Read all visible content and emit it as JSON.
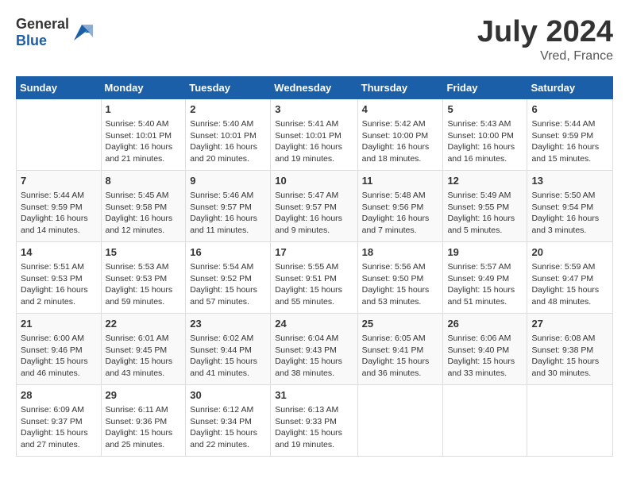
{
  "header": {
    "logo_general": "General",
    "logo_blue": "Blue",
    "month_year": "July 2024",
    "location": "Vred, France"
  },
  "weekdays": [
    "Sunday",
    "Monday",
    "Tuesday",
    "Wednesday",
    "Thursday",
    "Friday",
    "Saturday"
  ],
  "weeks": [
    [
      {
        "day": "",
        "sunrise": "",
        "sunset": "",
        "daylight": ""
      },
      {
        "day": "1",
        "sunrise": "Sunrise: 5:40 AM",
        "sunset": "Sunset: 10:01 PM",
        "daylight": "Daylight: 16 hours and 21 minutes."
      },
      {
        "day": "2",
        "sunrise": "Sunrise: 5:40 AM",
        "sunset": "Sunset: 10:01 PM",
        "daylight": "Daylight: 16 hours and 20 minutes."
      },
      {
        "day": "3",
        "sunrise": "Sunrise: 5:41 AM",
        "sunset": "Sunset: 10:01 PM",
        "daylight": "Daylight: 16 hours and 19 minutes."
      },
      {
        "day": "4",
        "sunrise": "Sunrise: 5:42 AM",
        "sunset": "Sunset: 10:00 PM",
        "daylight": "Daylight: 16 hours and 18 minutes."
      },
      {
        "day": "5",
        "sunrise": "Sunrise: 5:43 AM",
        "sunset": "Sunset: 10:00 PM",
        "daylight": "Daylight: 16 hours and 16 minutes."
      },
      {
        "day": "6",
        "sunrise": "Sunrise: 5:44 AM",
        "sunset": "Sunset: 9:59 PM",
        "daylight": "Daylight: 16 hours and 15 minutes."
      }
    ],
    [
      {
        "day": "7",
        "sunrise": "Sunrise: 5:44 AM",
        "sunset": "Sunset: 9:59 PM",
        "daylight": "Daylight: 16 hours and 14 minutes."
      },
      {
        "day": "8",
        "sunrise": "Sunrise: 5:45 AM",
        "sunset": "Sunset: 9:58 PM",
        "daylight": "Daylight: 16 hours and 12 minutes."
      },
      {
        "day": "9",
        "sunrise": "Sunrise: 5:46 AM",
        "sunset": "Sunset: 9:57 PM",
        "daylight": "Daylight: 16 hours and 11 minutes."
      },
      {
        "day": "10",
        "sunrise": "Sunrise: 5:47 AM",
        "sunset": "Sunset: 9:57 PM",
        "daylight": "Daylight: 16 hours and 9 minutes."
      },
      {
        "day": "11",
        "sunrise": "Sunrise: 5:48 AM",
        "sunset": "Sunset: 9:56 PM",
        "daylight": "Daylight: 16 hours and 7 minutes."
      },
      {
        "day": "12",
        "sunrise": "Sunrise: 5:49 AM",
        "sunset": "Sunset: 9:55 PM",
        "daylight": "Daylight: 16 hours and 5 minutes."
      },
      {
        "day": "13",
        "sunrise": "Sunrise: 5:50 AM",
        "sunset": "Sunset: 9:54 PM",
        "daylight": "Daylight: 16 hours and 3 minutes."
      }
    ],
    [
      {
        "day": "14",
        "sunrise": "Sunrise: 5:51 AM",
        "sunset": "Sunset: 9:53 PM",
        "daylight": "Daylight: 16 hours and 2 minutes."
      },
      {
        "day": "15",
        "sunrise": "Sunrise: 5:53 AM",
        "sunset": "Sunset: 9:53 PM",
        "daylight": "Daylight: 15 hours and 59 minutes."
      },
      {
        "day": "16",
        "sunrise": "Sunrise: 5:54 AM",
        "sunset": "Sunset: 9:52 PM",
        "daylight": "Daylight: 15 hours and 57 minutes."
      },
      {
        "day": "17",
        "sunrise": "Sunrise: 5:55 AM",
        "sunset": "Sunset: 9:51 PM",
        "daylight": "Daylight: 15 hours and 55 minutes."
      },
      {
        "day": "18",
        "sunrise": "Sunrise: 5:56 AM",
        "sunset": "Sunset: 9:50 PM",
        "daylight": "Daylight: 15 hours and 53 minutes."
      },
      {
        "day": "19",
        "sunrise": "Sunrise: 5:57 AM",
        "sunset": "Sunset: 9:49 PM",
        "daylight": "Daylight: 15 hours and 51 minutes."
      },
      {
        "day": "20",
        "sunrise": "Sunrise: 5:59 AM",
        "sunset": "Sunset: 9:47 PM",
        "daylight": "Daylight: 15 hours and 48 minutes."
      }
    ],
    [
      {
        "day": "21",
        "sunrise": "Sunrise: 6:00 AM",
        "sunset": "Sunset: 9:46 PM",
        "daylight": "Daylight: 15 hours and 46 minutes."
      },
      {
        "day": "22",
        "sunrise": "Sunrise: 6:01 AM",
        "sunset": "Sunset: 9:45 PM",
        "daylight": "Daylight: 15 hours and 43 minutes."
      },
      {
        "day": "23",
        "sunrise": "Sunrise: 6:02 AM",
        "sunset": "Sunset: 9:44 PM",
        "daylight": "Daylight: 15 hours and 41 minutes."
      },
      {
        "day": "24",
        "sunrise": "Sunrise: 6:04 AM",
        "sunset": "Sunset: 9:43 PM",
        "daylight": "Daylight: 15 hours and 38 minutes."
      },
      {
        "day": "25",
        "sunrise": "Sunrise: 6:05 AM",
        "sunset": "Sunset: 9:41 PM",
        "daylight": "Daylight: 15 hours and 36 minutes."
      },
      {
        "day": "26",
        "sunrise": "Sunrise: 6:06 AM",
        "sunset": "Sunset: 9:40 PM",
        "daylight": "Daylight: 15 hours and 33 minutes."
      },
      {
        "day": "27",
        "sunrise": "Sunrise: 6:08 AM",
        "sunset": "Sunset: 9:38 PM",
        "daylight": "Daylight: 15 hours and 30 minutes."
      }
    ],
    [
      {
        "day": "28",
        "sunrise": "Sunrise: 6:09 AM",
        "sunset": "Sunset: 9:37 PM",
        "daylight": "Daylight: 15 hours and 27 minutes."
      },
      {
        "day": "29",
        "sunrise": "Sunrise: 6:11 AM",
        "sunset": "Sunset: 9:36 PM",
        "daylight": "Daylight: 15 hours and 25 minutes."
      },
      {
        "day": "30",
        "sunrise": "Sunrise: 6:12 AM",
        "sunset": "Sunset: 9:34 PM",
        "daylight": "Daylight: 15 hours and 22 minutes."
      },
      {
        "day": "31",
        "sunrise": "Sunrise: 6:13 AM",
        "sunset": "Sunset: 9:33 PM",
        "daylight": "Daylight: 15 hours and 19 minutes."
      },
      {
        "day": "",
        "sunrise": "",
        "sunset": "",
        "daylight": ""
      },
      {
        "day": "",
        "sunrise": "",
        "sunset": "",
        "daylight": ""
      },
      {
        "day": "",
        "sunrise": "",
        "sunset": "",
        "daylight": ""
      }
    ]
  ]
}
